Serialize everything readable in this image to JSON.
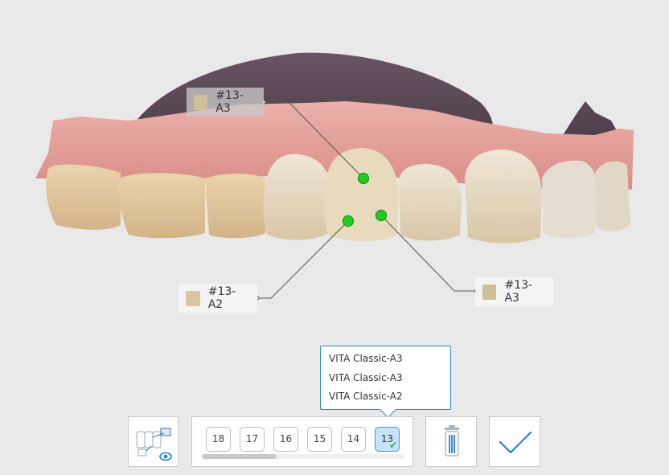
{
  "callouts": {
    "top_left": {
      "label": "#13-A3",
      "color": "#cfc099"
    },
    "lower_left": {
      "label": "#13-A2",
      "color": "#d6c7a0"
    },
    "right": {
      "label": "#13-A3",
      "color": "#cfbf98"
    }
  },
  "shade_popup": {
    "options": [
      "VITA Classic-A3",
      "VITA Classic-A3",
      "VITA Classic-A2"
    ]
  },
  "toolbar": {
    "teeth": [
      "18",
      "17",
      "16",
      "15",
      "14",
      "13"
    ],
    "active_tooth": "13",
    "scroll_fraction": 0.37,
    "accent": "#3d98e0",
    "check_color": "#27ae60",
    "icons": [
      "view-toggle-icon",
      "trash-icon",
      "confirm-check-icon"
    ]
  },
  "colors": {
    "gum": "#e0928c",
    "palate": "#5e4a58",
    "tooth": "#e9dcc3",
    "point": "#22cc22"
  }
}
